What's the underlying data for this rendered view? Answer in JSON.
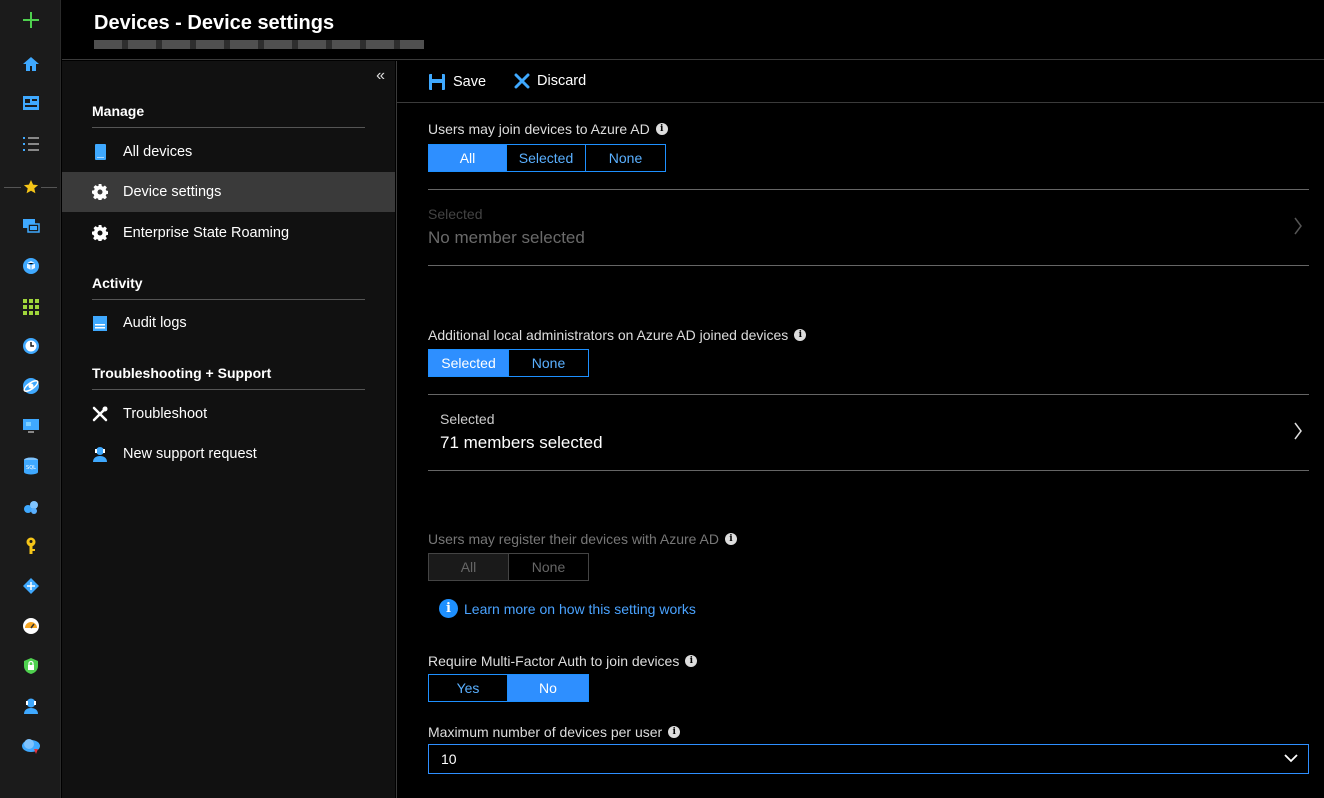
{
  "header": {
    "title": "Devices - Device settings"
  },
  "nav": {
    "collapse_label": "«",
    "sections": {
      "manage": "Manage",
      "activity": "Activity",
      "support": "Troubleshooting + Support"
    },
    "items": {
      "all_devices": "All devices",
      "device_settings": "Device settings",
      "enterprise_state_roaming": "Enterprise State Roaming",
      "audit_logs": "Audit logs",
      "troubleshoot": "Troubleshoot",
      "new_support_request": "New support request"
    }
  },
  "toolbar": {
    "save_label": "Save",
    "discard_label": "Discard"
  },
  "settings": {
    "join": {
      "label": "Users may join devices to Azure AD",
      "options": [
        "All",
        "Selected",
        "None"
      ],
      "selected": "All",
      "picker_small": "Selected",
      "picker_big": "No member selected"
    },
    "admins": {
      "label": "Additional local administrators on Azure AD joined devices",
      "options": [
        "Selected",
        "None"
      ],
      "selected": "Selected",
      "picker_small": "Selected",
      "picker_big": "71 members selected"
    },
    "register": {
      "label": "Users may register their devices with Azure AD",
      "options": [
        "All",
        "None"
      ],
      "learn_more": "Learn more on how this setting works"
    },
    "mfa": {
      "label": "Require Multi-Factor Auth to join devices",
      "options": [
        "Yes",
        "No"
      ],
      "selected": "No"
    },
    "max_devices": {
      "label": "Maximum number of devices per user",
      "value": "10"
    }
  },
  "colors": {
    "accent": "#2e8fff",
    "background": "#000000",
    "panel": "#111111",
    "rail": "#1b1b1b"
  }
}
